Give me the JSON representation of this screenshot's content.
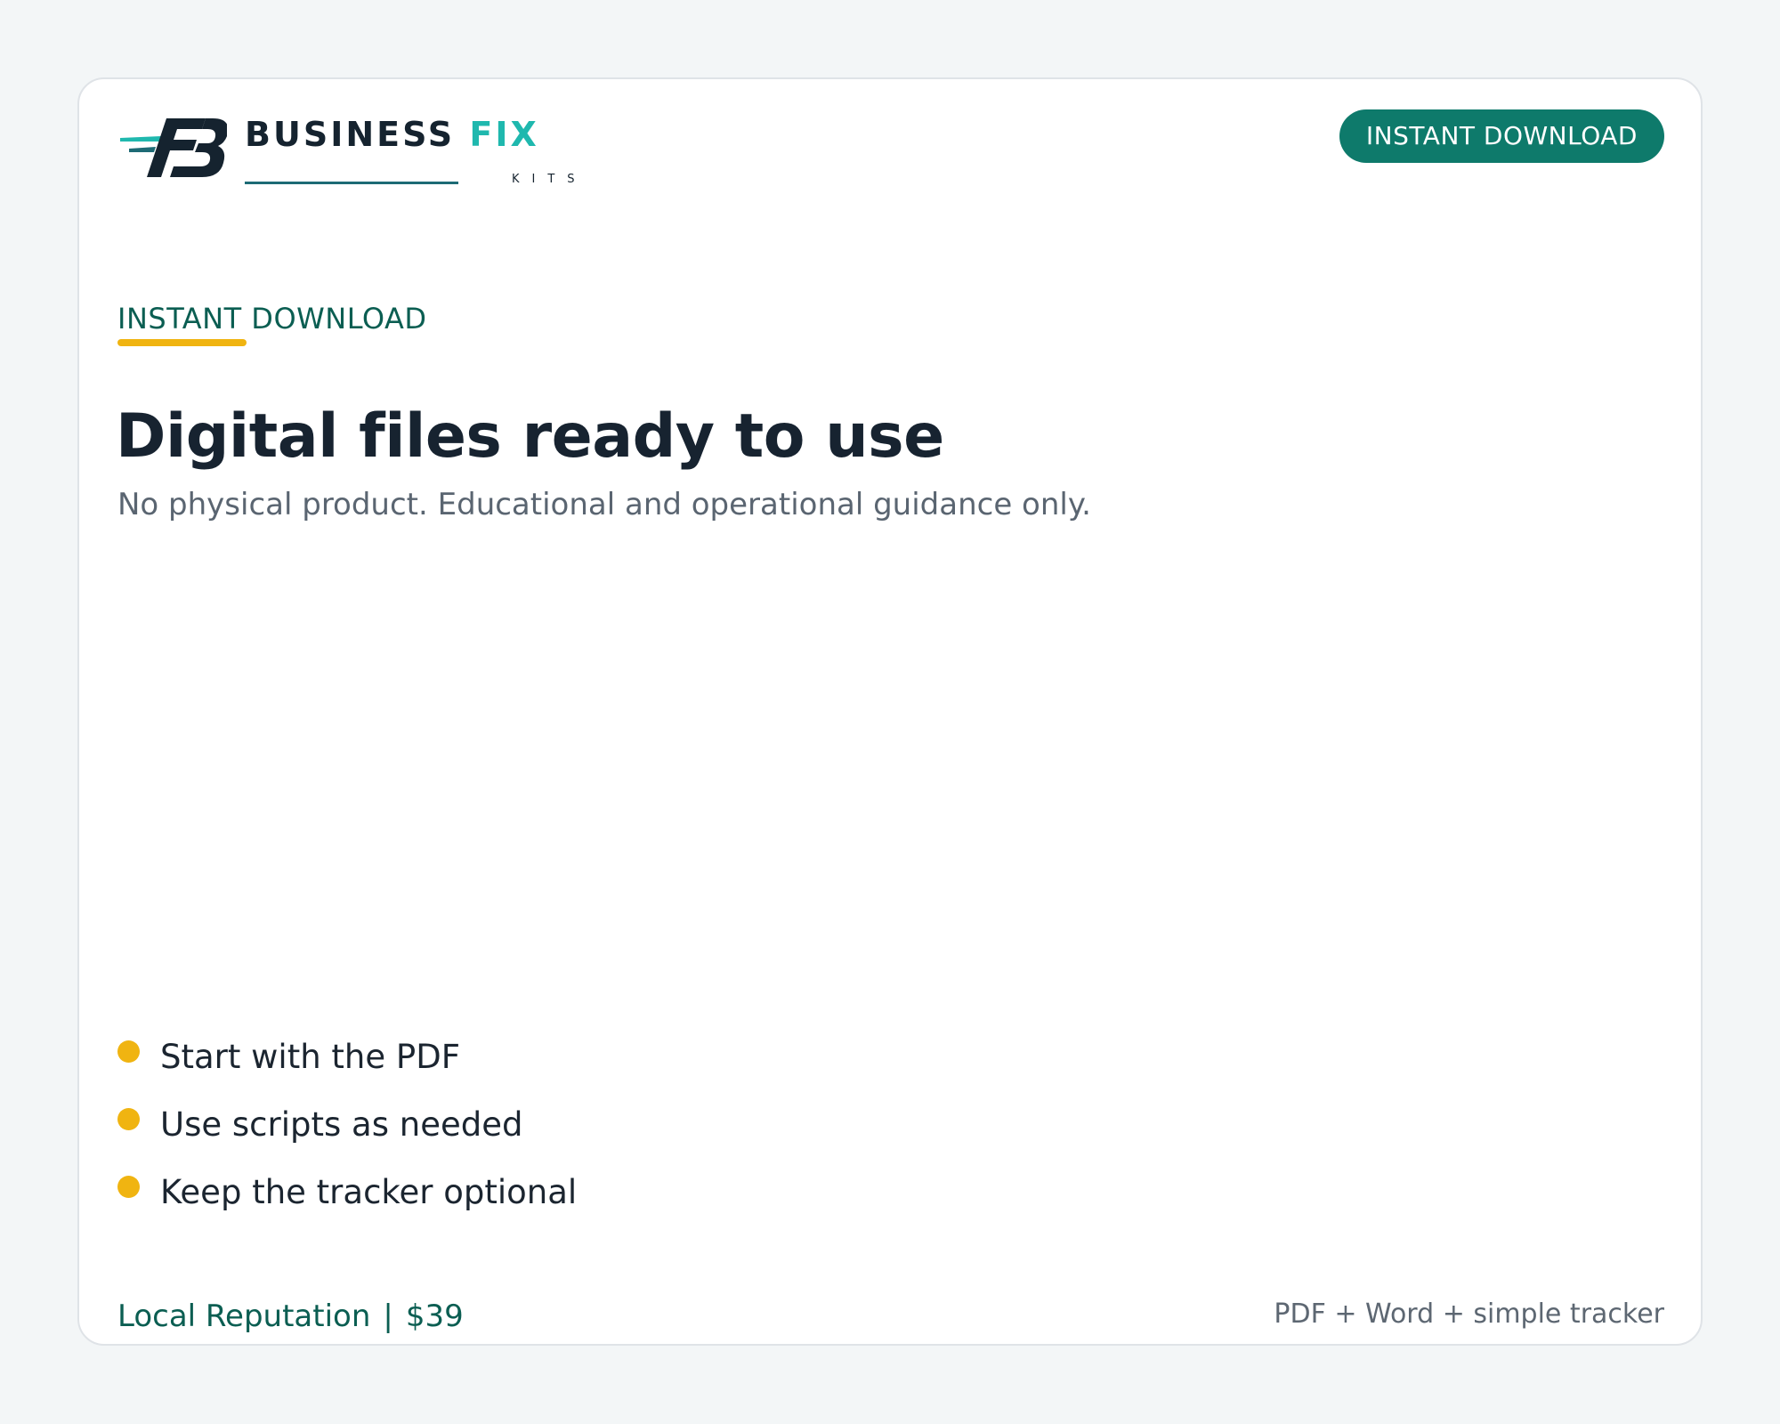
{
  "brand": {
    "name_part1": "BUSINESS",
    "name_part2": "FIX",
    "sub": "KITS"
  },
  "header": {
    "pill_label": "INSTANT DOWNLOAD"
  },
  "hero": {
    "eyebrow": "INSTANT DOWNLOAD",
    "title": "Digital files ready to use",
    "subtitle": "No physical product. Educational and operational guidance only."
  },
  "bullets": [
    "Start with the PDF",
    "Use scripts as needed",
    "Keep the tracker optional"
  ],
  "footer": {
    "product": "Local Reputation",
    "separator": "|",
    "price": "$39",
    "includes": "PDF + Word + simple tracker"
  },
  "colors": {
    "accent": "#0e7a6b",
    "eyebrow": "#0b5e52",
    "highlight": "#f0b411",
    "brand_teal": "#1fb8ae",
    "text_dark": "#172330"
  }
}
